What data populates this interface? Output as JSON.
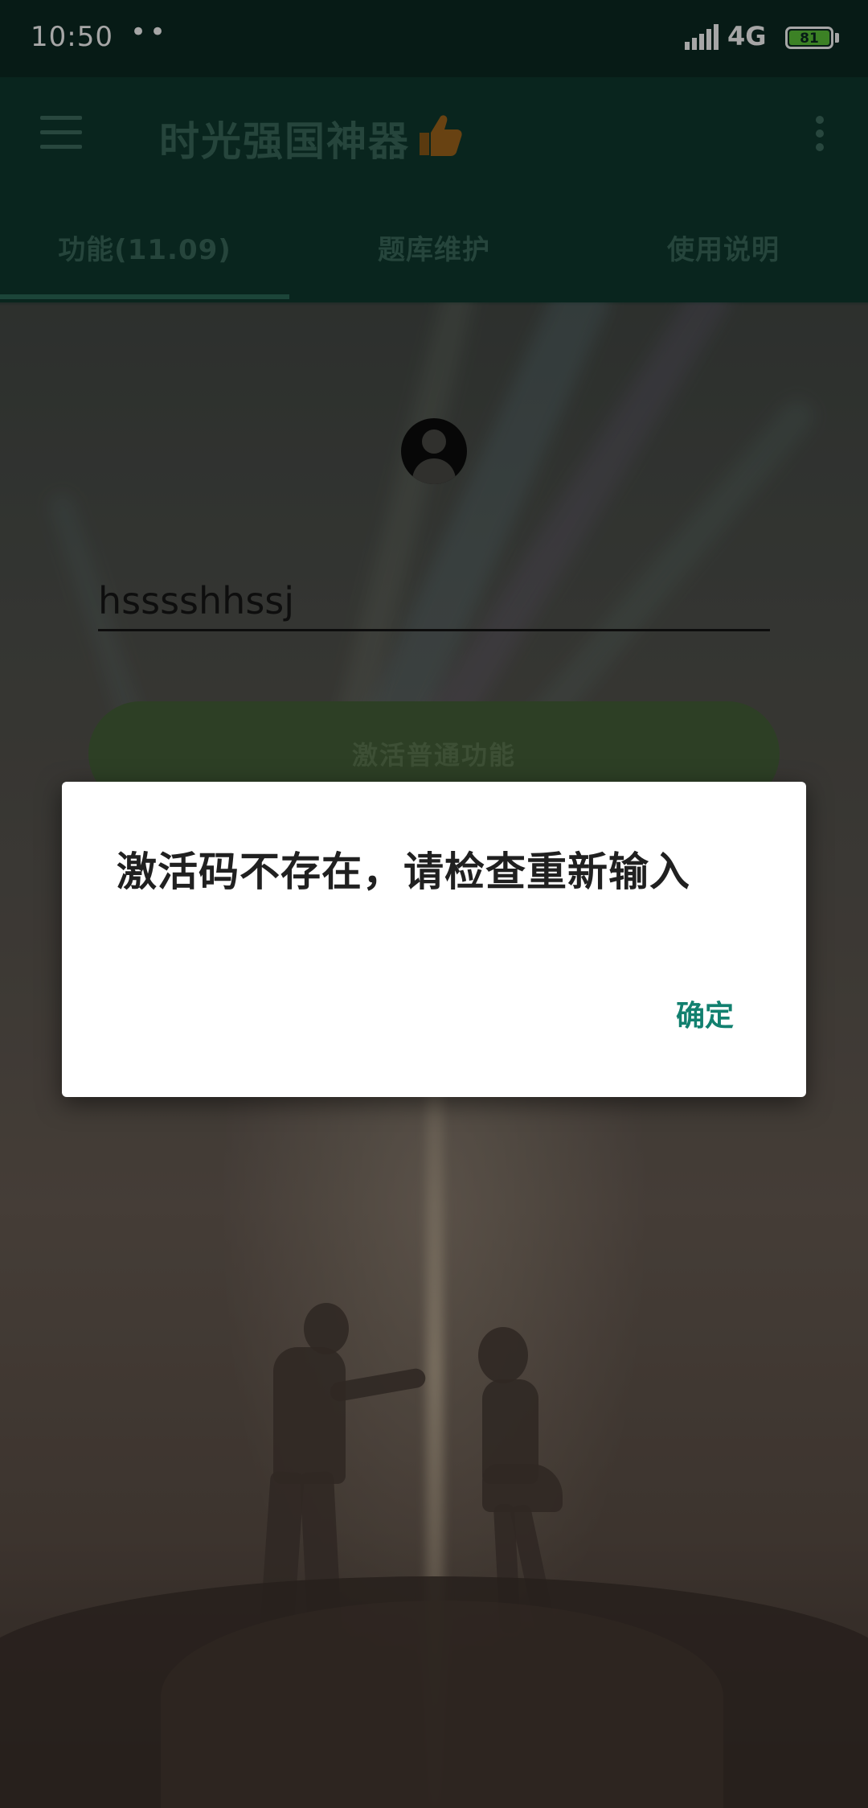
{
  "status_bar": {
    "time": "10:50",
    "notification_dots": "••",
    "network": "4G",
    "battery_level": "81",
    "battery_color": "#5cc63a"
  },
  "toolbar": {
    "title": "时光强国神器",
    "title_emoji_icon": "thumbs-up-icon",
    "menu_icon": "hamburger-menu-icon",
    "overflow_icon": "more-vert-icon",
    "background_color": "#0f3a2e"
  },
  "tabs": [
    {
      "label": "功能(11.09)",
      "selected": true
    },
    {
      "label": "题库维护",
      "selected": false
    },
    {
      "label": "使用说明",
      "selected": false
    }
  ],
  "main": {
    "avatar_icon": "account-circle-icon",
    "code_input_value": "hsssshhssj",
    "activate_button_label": "激活普通功能",
    "activate_button_color": "#46623a"
  },
  "dialog": {
    "message": "激活码不存在，请检查重新输入",
    "ok_label": "确定",
    "ok_color": "#12806f"
  }
}
